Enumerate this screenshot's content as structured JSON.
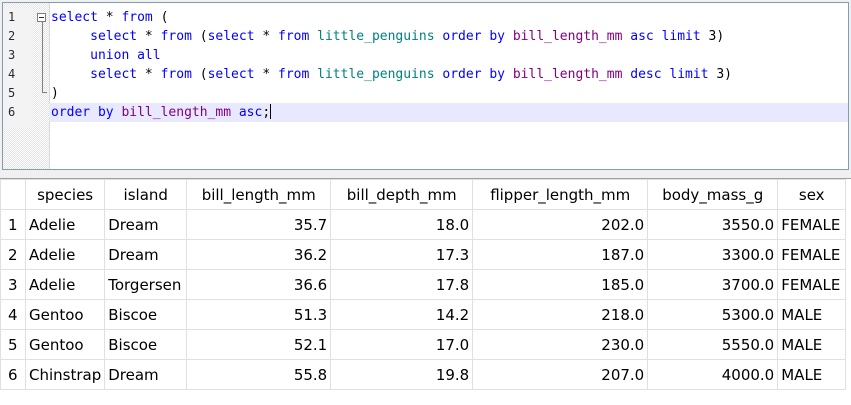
{
  "editor": {
    "line_numbers": [
      "1",
      "2",
      "3",
      "4",
      "5",
      "6"
    ],
    "lines": [
      [
        {
          "t": "select",
          "c": "kw"
        },
        {
          "t": " * ",
          "c": ""
        },
        {
          "t": "from",
          "c": "kw"
        },
        {
          "t": " (",
          "c": ""
        }
      ],
      [
        {
          "t": "     ",
          "c": ""
        },
        {
          "t": "select",
          "c": "kw"
        },
        {
          "t": " * ",
          "c": ""
        },
        {
          "t": "from",
          "c": "kw"
        },
        {
          "t": " (",
          "c": ""
        },
        {
          "t": "select",
          "c": "kw"
        },
        {
          "t": " * ",
          "c": ""
        },
        {
          "t": "from",
          "c": "kw"
        },
        {
          "t": " ",
          "c": ""
        },
        {
          "t": "little_penguins",
          "c": "tbl"
        },
        {
          "t": " ",
          "c": ""
        },
        {
          "t": "order by",
          "c": "kw"
        },
        {
          "t": " ",
          "c": ""
        },
        {
          "t": "bill_length_mm",
          "c": "col"
        },
        {
          "t": " ",
          "c": ""
        },
        {
          "t": "asc",
          "c": "kw"
        },
        {
          "t": " ",
          "c": ""
        },
        {
          "t": "limit",
          "c": "kw"
        },
        {
          "t": " 3)",
          "c": ""
        }
      ],
      [
        {
          "t": "     ",
          "c": ""
        },
        {
          "t": "union all",
          "c": "kw"
        }
      ],
      [
        {
          "t": "     ",
          "c": ""
        },
        {
          "t": "select",
          "c": "kw"
        },
        {
          "t": " * ",
          "c": ""
        },
        {
          "t": "from",
          "c": "kw"
        },
        {
          "t": " (",
          "c": ""
        },
        {
          "t": "select",
          "c": "kw"
        },
        {
          "t": " * ",
          "c": ""
        },
        {
          "t": "from",
          "c": "kw"
        },
        {
          "t": " ",
          "c": ""
        },
        {
          "t": "little_penguins",
          "c": "tbl"
        },
        {
          "t": " ",
          "c": ""
        },
        {
          "t": "order by",
          "c": "kw"
        },
        {
          "t": " ",
          "c": ""
        },
        {
          "t": "bill_length_mm",
          "c": "col"
        },
        {
          "t": " ",
          "c": ""
        },
        {
          "t": "desc",
          "c": "kw"
        },
        {
          "t": " ",
          "c": ""
        },
        {
          "t": "limit",
          "c": "kw"
        },
        {
          "t": " 3)",
          "c": ""
        }
      ],
      [
        {
          "t": ")",
          "c": ""
        }
      ],
      [
        {
          "t": "order by",
          "c": "kw"
        },
        {
          "t": " ",
          "c": ""
        },
        {
          "t": "bill_length_mm",
          "c": "col"
        },
        {
          "t": " ",
          "c": ""
        },
        {
          "t": "asc",
          "c": "kw"
        },
        {
          "t": ";",
          "c": ""
        }
      ]
    ],
    "current_line": 6
  },
  "results": {
    "columns": [
      "species",
      "island",
      "bill_length_mm",
      "bill_depth_mm",
      "flipper_length_mm",
      "body_mass_g",
      "sex"
    ],
    "rows": [
      {
        "n": "1",
        "cells": [
          "Adelie",
          "Dream",
          "35.7",
          "18.0",
          "202.0",
          "3550.0",
          "FEMALE"
        ]
      },
      {
        "n": "2",
        "cells": [
          "Adelie",
          "Dream",
          "36.2",
          "17.3",
          "187.0",
          "3300.0",
          "FEMALE"
        ]
      },
      {
        "n": "3",
        "cells": [
          "Adelie",
          "Torgersen",
          "36.6",
          "17.8",
          "185.0",
          "3700.0",
          "FEMALE"
        ]
      },
      {
        "n": "4",
        "cells": [
          "Gentoo",
          "Biscoe",
          "51.3",
          "14.2",
          "218.0",
          "5300.0",
          "MALE"
        ]
      },
      {
        "n": "5",
        "cells": [
          "Gentoo",
          "Biscoe",
          "52.1",
          "17.0",
          "230.0",
          "5550.0",
          "MALE"
        ]
      },
      {
        "n": "6",
        "cells": [
          "Chinstrap",
          "Dream",
          "55.8",
          "19.8",
          "207.0",
          "4000.0",
          "MALE"
        ]
      }
    ]
  }
}
